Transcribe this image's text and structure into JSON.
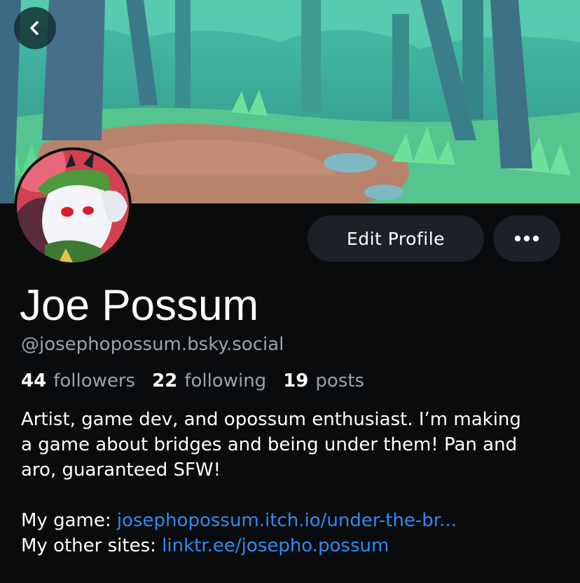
{
  "nav": {
    "back_icon": "chevron-left-icon"
  },
  "profile": {
    "display_name": "Joe Possum",
    "handle": "@josephopossum.bsky.social",
    "edit_label": "Edit Profile",
    "more_icon": "ellipsis-icon"
  },
  "stats": [
    {
      "count": "44",
      "label": "followers"
    },
    {
      "count": "22",
      "label": "following"
    },
    {
      "count": "19",
      "label": "posts"
    }
  ],
  "bio": {
    "lines": [
      "Artist, game dev, and opossum enthusiast. I’m making",
      "a game about bridges and being under them! Pan and",
      "aro, guaranteed SFW!"
    ]
  },
  "links": {
    "game_prefix": "My game: ",
    "game_url": "josephopossum.itch.io/under-the-br...",
    "sites_prefix": "My other sites: ",
    "sites_url": "linktr.ee/josepho.possum"
  },
  "colors": {
    "background": "#0a0b0d",
    "button": "#1c2128",
    "muted_text": "#9aa3ad",
    "link": "#2d8bf2"
  }
}
